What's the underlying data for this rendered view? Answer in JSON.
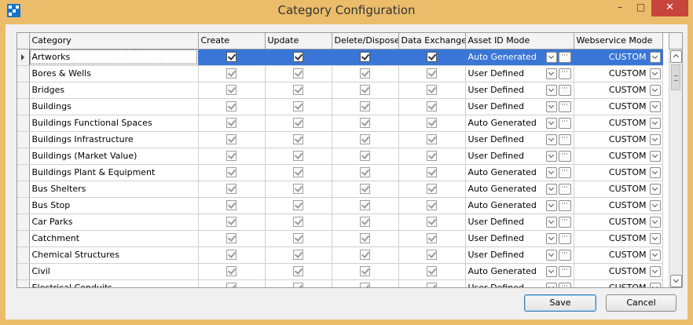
{
  "window": {
    "title": "Category Configuration",
    "controls": {
      "minimize": "–",
      "maximize": "□",
      "close": "✕"
    },
    "icon": "app-grid-icon"
  },
  "grid": {
    "columns": [
      "Category",
      "Create",
      "Update",
      "Delete/Dispose",
      "Data Exchange",
      "Asset ID Mode",
      "Webservice Mode"
    ],
    "selected_row": 0,
    "rows": [
      {
        "category": "Artworks",
        "create": true,
        "update": true,
        "delete": true,
        "exchange": true,
        "asset_id_mode": "Auto Generated",
        "webservice_mode": "CUSTOM"
      },
      {
        "category": "Bores & Wells",
        "create": true,
        "update": true,
        "delete": true,
        "exchange": true,
        "asset_id_mode": "User Defined",
        "webservice_mode": "CUSTOM"
      },
      {
        "category": "Bridges",
        "create": true,
        "update": true,
        "delete": true,
        "exchange": true,
        "asset_id_mode": "User Defined",
        "webservice_mode": "CUSTOM"
      },
      {
        "category": "Buildings",
        "create": true,
        "update": true,
        "delete": true,
        "exchange": true,
        "asset_id_mode": "User Defined",
        "webservice_mode": "CUSTOM"
      },
      {
        "category": "Buildings Functional Spaces",
        "create": true,
        "update": true,
        "delete": true,
        "exchange": true,
        "asset_id_mode": "Auto Generated",
        "webservice_mode": "CUSTOM"
      },
      {
        "category": "Buildings Infrastructure",
        "create": true,
        "update": true,
        "delete": true,
        "exchange": true,
        "asset_id_mode": "User Defined",
        "webservice_mode": "CUSTOM"
      },
      {
        "category": "Buildings (Market Value)",
        "create": true,
        "update": true,
        "delete": true,
        "exchange": true,
        "asset_id_mode": "User Defined",
        "webservice_mode": "CUSTOM"
      },
      {
        "category": "Buildings Plant & Equipment",
        "create": true,
        "update": true,
        "delete": true,
        "exchange": true,
        "asset_id_mode": "Auto Generated",
        "webservice_mode": "CUSTOM"
      },
      {
        "category": "Bus Shelters",
        "create": true,
        "update": true,
        "delete": true,
        "exchange": true,
        "asset_id_mode": "Auto Generated",
        "webservice_mode": "CUSTOM"
      },
      {
        "category": "Bus Stop",
        "create": true,
        "update": true,
        "delete": true,
        "exchange": true,
        "asset_id_mode": "Auto Generated",
        "webservice_mode": "CUSTOM"
      },
      {
        "category": "Car Parks",
        "create": true,
        "update": true,
        "delete": true,
        "exchange": true,
        "asset_id_mode": "User Defined",
        "webservice_mode": "CUSTOM"
      },
      {
        "category": "Catchment",
        "create": true,
        "update": true,
        "delete": true,
        "exchange": true,
        "asset_id_mode": "User Defined",
        "webservice_mode": "CUSTOM"
      },
      {
        "category": "Chemical Structures",
        "create": true,
        "update": true,
        "delete": true,
        "exchange": true,
        "asset_id_mode": "User Defined",
        "webservice_mode": "CUSTOM"
      },
      {
        "category": "Civil",
        "create": true,
        "update": true,
        "delete": true,
        "exchange": true,
        "asset_id_mode": "Auto Generated",
        "webservice_mode": "CUSTOM"
      },
      {
        "category": "Electrical Conduits",
        "create": true,
        "update": true,
        "delete": true,
        "exchange": true,
        "asset_id_mode": "User Defined",
        "webservice_mode": "CUSTOM"
      }
    ],
    "ellipsis_label": "···"
  },
  "buttons": {
    "save": "Save",
    "cancel": "Cancel"
  },
  "colors": {
    "selection": "#3a76d6",
    "frame": "#ebbd6a",
    "close": "#c7453b"
  }
}
